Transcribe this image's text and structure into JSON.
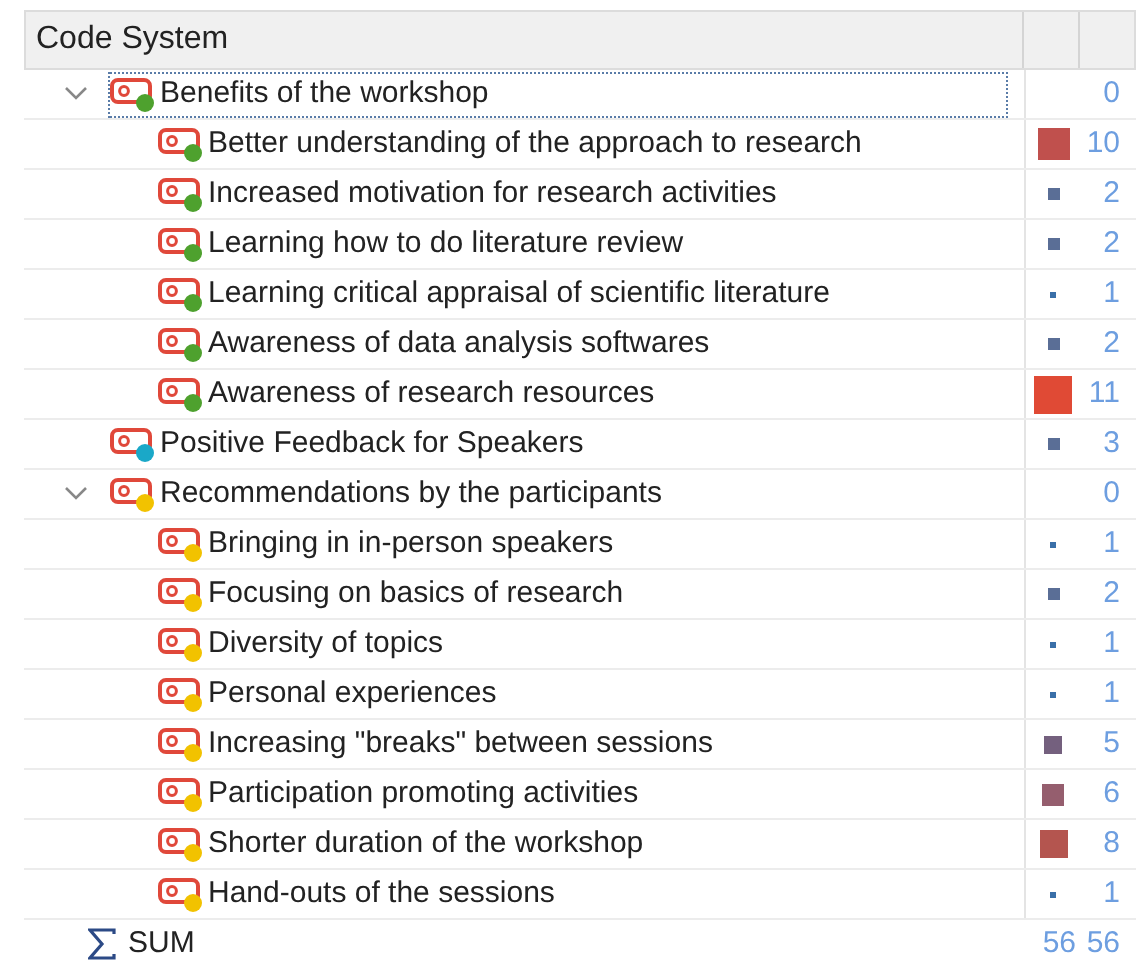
{
  "header": {
    "title": "Code System"
  },
  "codes": [
    {
      "label": "Benefits of the workshop",
      "color": "#4ea12e",
      "count": "0",
      "kind": "none",
      "expanded": true,
      "selected": true,
      "children": [
        {
          "label": "Better understanding of the approach to research",
          "color": "#4ea12e",
          "count": "10",
          "kind": "huge",
          "selected": false
        },
        {
          "label": "Increased motivation for research activities",
          "color": "#4ea12e",
          "count": "2",
          "kind": "small",
          "selected": false
        },
        {
          "label": "Learning how to do literature review",
          "color": "#4ea12e",
          "count": "2",
          "kind": "small",
          "selected": false
        },
        {
          "label": "Learning critical appraisal of scientific literature",
          "color": "#4ea12e",
          "count": "1",
          "kind": "tiny",
          "selected": false
        },
        {
          "label": "Awareness of data analysis softwares",
          "color": "#4ea12e",
          "count": "2",
          "kind": "small",
          "selected": false
        },
        {
          "label": "Awareness of research resources",
          "color": "#4ea12e",
          "count": "11",
          "kind": "max",
          "selected": false
        }
      ]
    },
    {
      "label": "Positive Feedback for Speakers",
      "color": "#1aa8c8",
      "count": "3",
      "kind": "small",
      "selected": false
    },
    {
      "label": "Recommendations by the participants",
      "color": "#f2c200",
      "count": "0",
      "kind": "none",
      "expanded": true,
      "selected": false,
      "children": [
        {
          "label": "Bringing in in-person speakers",
          "color": "#f2c200",
          "count": "1",
          "kind": "tiny",
          "selected": false
        },
        {
          "label": "Focusing on basics of research",
          "color": "#f2c200",
          "count": "2",
          "kind": "small",
          "selected": false
        },
        {
          "label": "Diversity of topics",
          "color": "#f2c200",
          "count": "1",
          "kind": "tiny",
          "selected": false
        },
        {
          "label": "Personal experiences",
          "color": "#f2c200",
          "count": "1",
          "kind": "tiny",
          "selected": false
        },
        {
          "label": "Increasing \"breaks\" between sessions",
          "color": "#f2c200",
          "count": "5",
          "kind": "medium",
          "selected": false
        },
        {
          "label": "Participation promoting activities",
          "color": "#f2c200",
          "count": "6",
          "kind": "large",
          "selected": false
        },
        {
          "label": "Shorter duration of the workshop",
          "color": "#f2c200",
          "count": "8",
          "kind": "xlarge",
          "selected": false
        },
        {
          "label": "Hand-outs of the sessions",
          "color": "#f2c200",
          "count": "1",
          "kind": "tiny",
          "selected": false
        }
      ]
    }
  ],
  "sum": {
    "label": "SUM",
    "total_1": "56",
    "total_2": "56"
  }
}
